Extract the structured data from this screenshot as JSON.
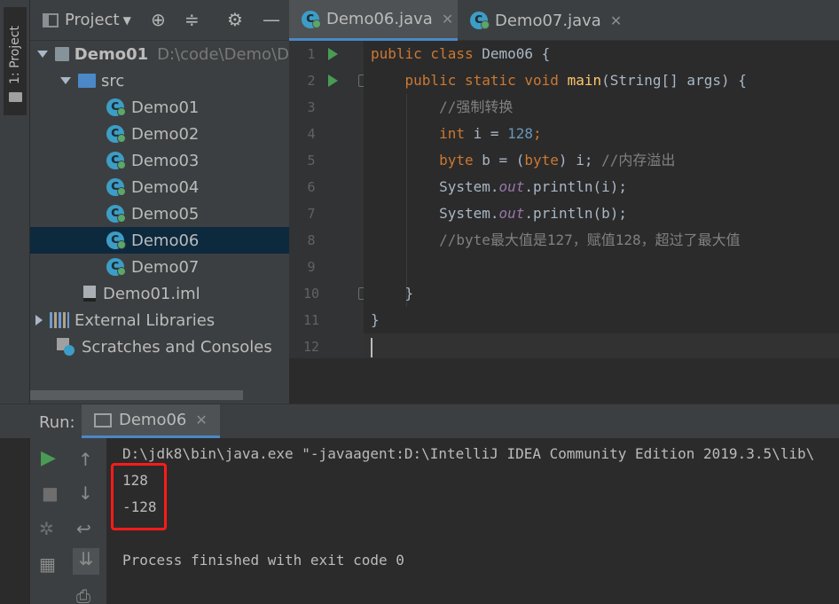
{
  "tool_strip": {
    "project_tab": "1: Project"
  },
  "project_panel": {
    "title": "Project",
    "tree": [
      {
        "label": "Demo01",
        "extra": "D:\\code\\Demo\\D",
        "kind": "module"
      },
      {
        "label": "src",
        "kind": "folder"
      },
      {
        "label": "Demo01",
        "kind": "class"
      },
      {
        "label": "Demo02",
        "kind": "class"
      },
      {
        "label": "Demo03",
        "kind": "class"
      },
      {
        "label": "Demo04",
        "kind": "class"
      },
      {
        "label": "Demo05",
        "kind": "class"
      },
      {
        "label": "Demo06",
        "kind": "class",
        "selected": true
      },
      {
        "label": "Demo07",
        "kind": "class"
      },
      {
        "label": "Demo01.iml",
        "kind": "iml"
      },
      {
        "label": "External Libraries",
        "kind": "libraries"
      },
      {
        "label": "Scratches and Consoles",
        "kind": "scratches"
      }
    ]
  },
  "editor": {
    "tabs": [
      {
        "label": "Demo06.java",
        "active": true
      },
      {
        "label": "Demo07.java",
        "active": false
      }
    ],
    "line_numbers": [
      "1",
      "2",
      "3",
      "4",
      "5",
      "6",
      "7",
      "8",
      "9",
      "10",
      "11",
      "12"
    ],
    "code": {
      "l1_kw": "public class",
      "l1_rest": " Demo06 {",
      "l2_kw": "public static void",
      "l2_fn": "main",
      "l2_rest": "(String[] args) {",
      "l3_cm": "//强制转换",
      "l4_kw": "int",
      "l4_mid": " i = ",
      "l4_num": "128",
      "l4_end": ";",
      "l5_kw1": "byte",
      "l5_mid": " b = (",
      "l5_kw2": "byte",
      "l5_rest": ") i; ",
      "l5_cm": "//内存溢出",
      "l6_a": "System.",
      "l6_b": "out",
      "l6_c": ".println(i);",
      "l7_a": "System.",
      "l7_b": "out",
      "l7_c": ".println(b);",
      "l8_cm": "//byte最大值是127，赋值128，超过了最大值",
      "l10": "}",
      "l11": "}"
    }
  },
  "run_panel": {
    "label": "Run:",
    "tab": "Demo06",
    "output": {
      "command": "D:\\jdk8\\bin\\java.exe \"-javaagent:D:\\IntelliJ IDEA Community Edition 2019.3.5\\lib\\",
      "line1": "128",
      "line2": "-128",
      "finish": "Process finished with exit code 0"
    }
  },
  "colors": {
    "keyword": "#cc7832",
    "function": "#ffc66d",
    "number": "#6897bb",
    "comment": "#808080",
    "static_field": "#9876aa",
    "highlight_box": "#ff1a1a"
  }
}
